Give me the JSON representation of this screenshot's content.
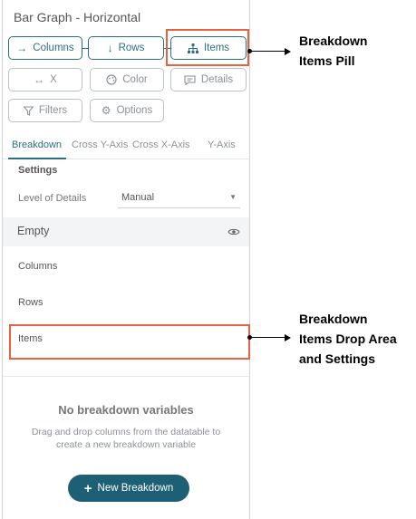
{
  "panel": {
    "title": "Bar Graph - Horizontal",
    "pills": {
      "columns": {
        "label": "Columns",
        "icon": "arrow-right-icon"
      },
      "rows": {
        "label": "Rows",
        "icon": "arrow-down-icon"
      },
      "items": {
        "label": "Items",
        "icon": "hierarchy-icon"
      },
      "x": {
        "label": "X",
        "icon": "double-arrow-icon"
      },
      "color": {
        "label": "Color",
        "icon": "palette-icon"
      },
      "details": {
        "label": "Details",
        "icon": "speech-bubble-icon"
      },
      "filters": {
        "label": "Filters",
        "icon": "filter-icon"
      },
      "options": {
        "label": "Options",
        "icon": "gear-icon"
      }
    },
    "tabs": [
      "Breakdown",
      "Cross Y-Axis",
      "Cross X-Axis",
      "Y-Axis"
    ],
    "active_tab": "Breakdown",
    "settings": {
      "title": "Settings",
      "level_of_details_label": "Level of Details",
      "level_of_details_value": "Manual"
    },
    "empty": {
      "label": "Empty",
      "icon": "eye-icon"
    },
    "drop_areas": {
      "columns": "Columns",
      "rows": "Rows",
      "items": "Items"
    },
    "no_breakdown": {
      "title": "No breakdown variables",
      "description": "Drag and drop columns from the datatable to create a new breakdown variable"
    },
    "new_breakdown_button": "New Breakdown"
  },
  "annotations": {
    "pill": [
      "Breakdown",
      "Items Pill"
    ],
    "drop_area": [
      "Breakdown",
      "Items Drop Area",
      "and Settings"
    ]
  },
  "colors": {
    "accent": "#2b6f82",
    "button": "#1d5f74",
    "highlight": "#e6633f"
  }
}
